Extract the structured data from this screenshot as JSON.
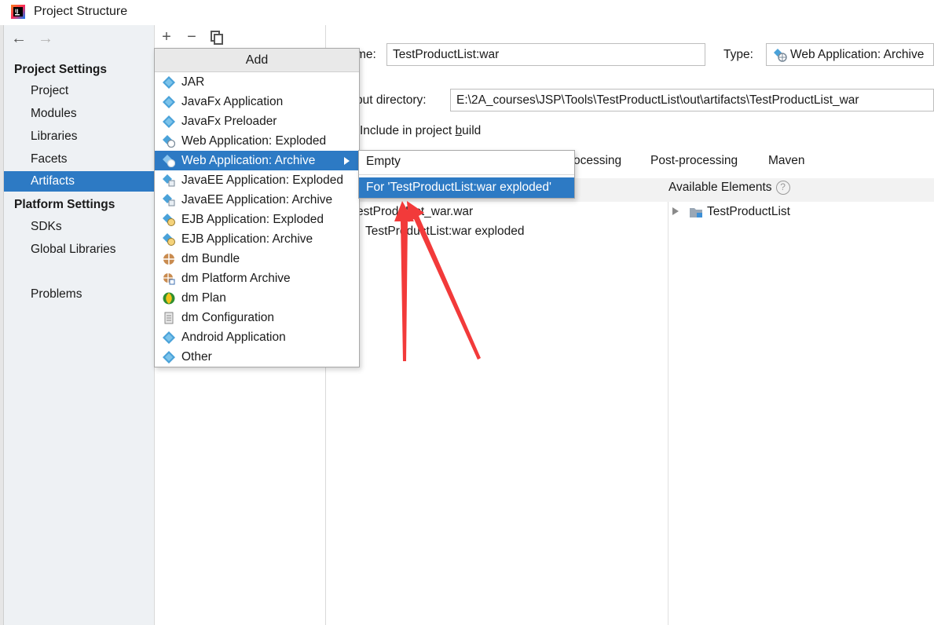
{
  "window": {
    "title": "Project Structure"
  },
  "sidebar": {
    "back_glyph": "←",
    "forward_glyph": "→",
    "project_settings_header": "Project Settings",
    "project_settings_items": [
      "Project",
      "Modules",
      "Libraries",
      "Facets",
      "Artifacts"
    ],
    "selected_item": "Artifacts",
    "platform_settings_header": "Platform Settings",
    "platform_settings_items": [
      "SDKs",
      "Global Libraries"
    ],
    "problems": "Problems"
  },
  "toolbar": {
    "add_glyph": "+",
    "remove_glyph": "−"
  },
  "add_menu": {
    "title": "Add",
    "items": [
      {
        "label": "JAR",
        "icon": "artifact-diamond-icon"
      },
      {
        "label": "JavaFx Application",
        "icon": "artifact-diamond-icon"
      },
      {
        "label": "JavaFx Preloader",
        "icon": "artifact-diamond-icon"
      },
      {
        "label": "Web Application: Exploded",
        "icon": "web-artifact-icon"
      },
      {
        "label": "Web Application: Archive",
        "icon": "web-artifact-icon",
        "selected": true,
        "has_submenu": true
      },
      {
        "label": "JavaEE Application: Exploded",
        "icon": "javaee-artifact-icon"
      },
      {
        "label": "JavaEE Application: Archive",
        "icon": "javaee-artifact-icon"
      },
      {
        "label": "EJB Application: Exploded",
        "icon": "ejb-artifact-icon"
      },
      {
        "label": "EJB Application: Archive",
        "icon": "ejb-artifact-icon"
      },
      {
        "label": "dm Bundle",
        "icon": "bundle-icon"
      },
      {
        "label": "dm Platform Archive",
        "icon": "platform-archive-icon"
      },
      {
        "label": "dm Plan",
        "icon": "plan-icon"
      },
      {
        "label": "dm Configuration",
        "icon": "configuration-icon"
      },
      {
        "label": "Android Application",
        "icon": "artifact-diamond-icon"
      },
      {
        "label": "Other",
        "icon": "artifact-diamond-icon"
      }
    ]
  },
  "submenu": {
    "items": [
      {
        "label": "Empty"
      },
      {
        "label": "For 'TestProductList:war exploded'",
        "selected": true
      }
    ]
  },
  "form": {
    "name_label": "me:",
    "name_value": "TestProductList:war",
    "type_label": "Type:",
    "type_value": "Web Application: Archive",
    "output_label": "put directory:",
    "output_value": "E:\\2A_courses\\JSP\\Tools\\TestProductList\\out\\artifacts\\TestProductList_war",
    "include_label": "Include in project ",
    "include_underlined": "b",
    "include_rest": "uild"
  },
  "tabs": [
    "ocessing",
    "Post-processing",
    "Maven"
  ],
  "output_tree": {
    "war_file": "estProdu",
    "war_file_tail": "List_war.war",
    "exploded_prefix": "TestProd",
    "exploded_tail": "uctList:war exploded"
  },
  "available": {
    "label": "Available Elements",
    "help_glyph": "?",
    "root": "TestProductList"
  },
  "colors": {
    "selection": "#2d7ac4",
    "annotation_arrow": "#f23a3a"
  }
}
